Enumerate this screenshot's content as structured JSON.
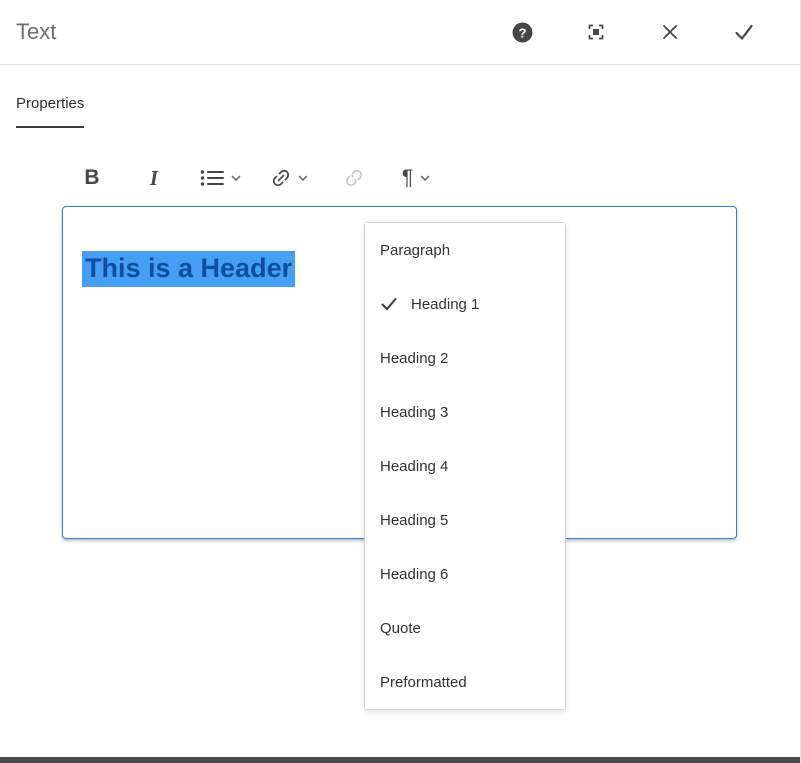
{
  "header": {
    "title": "Text",
    "help_glyph": "?"
  },
  "tabs": {
    "properties_label": "Properties"
  },
  "toolbar": {
    "bold_label": "B",
    "italic_label": "I",
    "pilcrow_label": "¶"
  },
  "editor": {
    "selected_text": "This is a Header"
  },
  "format_menu": {
    "items": [
      {
        "label": "Paragraph",
        "selected": false
      },
      {
        "label": "Heading 1",
        "selected": true
      },
      {
        "label": "Heading 2",
        "selected": false
      },
      {
        "label": "Heading 3",
        "selected": false
      },
      {
        "label": "Heading 4",
        "selected": false
      },
      {
        "label": "Heading 5",
        "selected": false
      },
      {
        "label": "Heading 6",
        "selected": false
      },
      {
        "label": "Quote",
        "selected": false
      },
      {
        "label": "Preformatted",
        "selected": false
      }
    ]
  },
  "colors": {
    "accent_blue": "#2680eb",
    "selection_background": "#459ff5",
    "selection_text": "#0d4f9e",
    "icon_gray": "#464646",
    "disabled_icon": "#c9c9c9",
    "divider": "#e4e4e4",
    "bottom_bar": "#4a4a4a"
  }
}
